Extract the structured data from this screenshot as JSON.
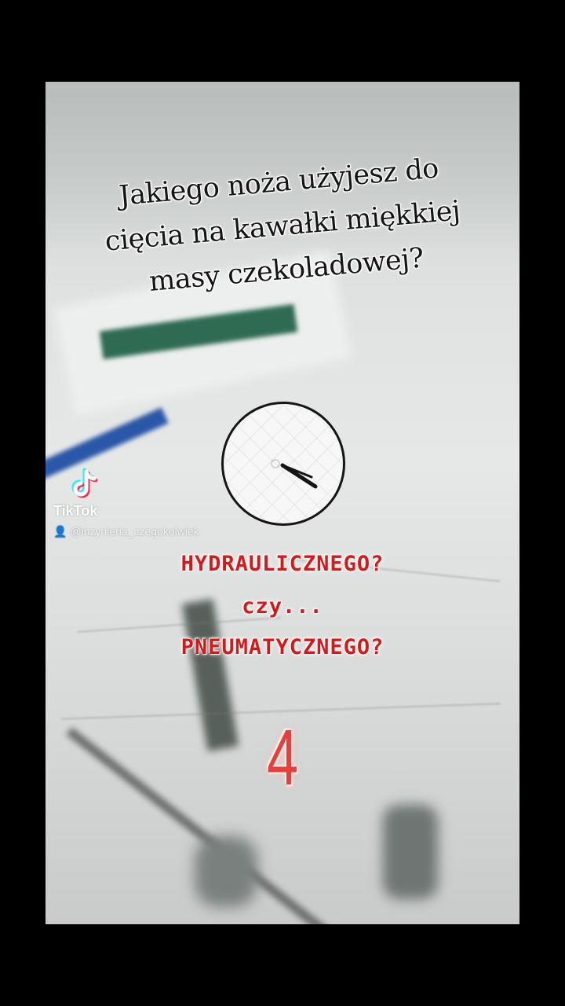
{
  "question": {
    "lines": [
      "Jakiego noża użyjesz do",
      "cięcia na kawałki miękkiej",
      "masy czekoladowej?"
    ]
  },
  "watermark": {
    "brand": "TikTok",
    "username": "@inzynieria_czegokolwiek",
    "icon": "tiktok-logo-icon"
  },
  "timer": {
    "icon": "clock-timer-icon"
  },
  "answers": {
    "option_1": "HYDRAULICZNEGO?",
    "separator": "czy...",
    "option_2": "PNEUMATYCZNEGO?"
  },
  "countdown": {
    "value": "4"
  },
  "colors": {
    "answer_red": "#d81818",
    "countdown_red": "#e6403c",
    "background": "#000000"
  }
}
